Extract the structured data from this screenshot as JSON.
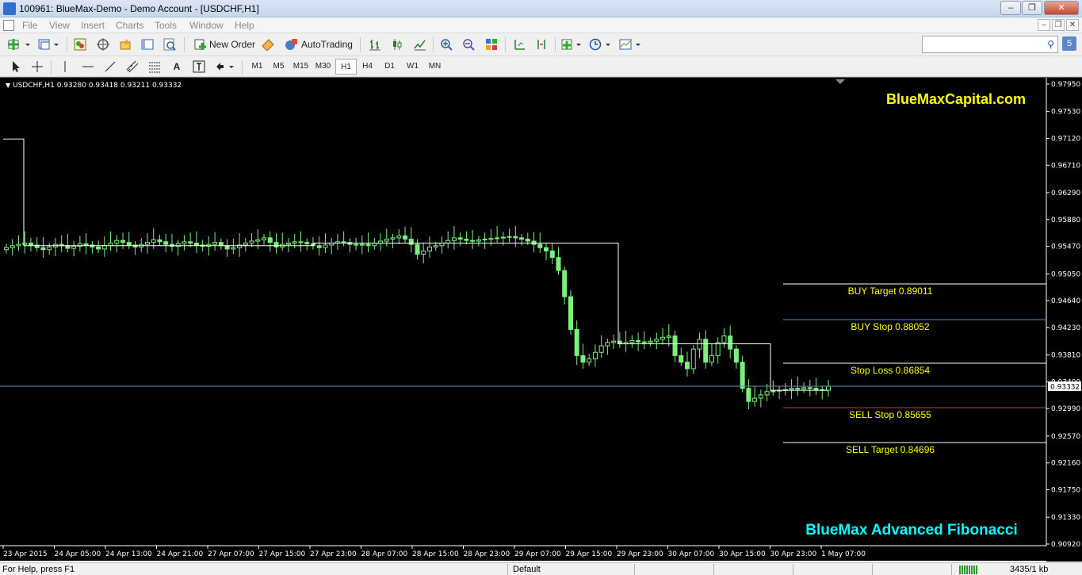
{
  "window": {
    "title": "100961: BlueMax-Demo - Demo Account - [USDCHF,H1]"
  },
  "menu": [
    "File",
    "View",
    "Insert",
    "Charts",
    "Tools",
    "Window",
    "Help"
  ],
  "toolbar": {
    "new_order_label": "New Order",
    "autotrading_label": "AutoTrading",
    "timeframes": [
      "M1",
      "M5",
      "M15",
      "M30",
      "H1",
      "H4",
      "D1",
      "W1",
      "MN"
    ],
    "active_timeframe": "H1",
    "search_placeholder": ""
  },
  "chart": {
    "symbol_info": "USDCHF,H1  0.93280 0.93418 0.93211 0.93332",
    "brand_top": "BlueMaxCapital.com",
    "brand_bottom": "BlueMax Advanced Fibonacci",
    "current_price": "0.93332",
    "price_labels": [
      "0.97950",
      "0.97530",
      "0.97120",
      "0.96710",
      "0.96290",
      "0.95880",
      "0.95470",
      "0.95050",
      "0.94640",
      "0.94230",
      "0.93810",
      "0.93400",
      "0.92990",
      "0.92570",
      "0.92160",
      "0.91750",
      "0.91330",
      "0.90920"
    ],
    "time_labels": [
      "23 Apr 2015",
      "24 Apr 05:00",
      "24 Apr 13:00",
      "24 Apr 21:00",
      "27 Apr 07:00",
      "27 Apr 15:00",
      "27 Apr 23:00",
      "28 Apr 07:00",
      "28 Apr 15:00",
      "28 Apr 23:00",
      "29 Apr 07:00",
      "29 Apr 15:00",
      "29 Apr 23:00",
      "30 Apr 07:00",
      "30 Apr 15:00",
      "30 Apr 23:00",
      "1 May 07:00"
    ],
    "levels": [
      {
        "label": "BUY Target",
        "value": "0.89011",
        "color": "#ffffff"
      },
      {
        "label": "BUY Stop",
        "value": "0.88052",
        "color": "#3b8fd1"
      },
      {
        "label": "Stop Loss",
        "value": "0.86854",
        "color": "#ffffff"
      },
      {
        "label": "SELL Stop",
        "value": "0.85655",
        "color": "#c0392b"
      },
      {
        "label": "SELL Target",
        "value": "0.84696",
        "color": "#ffffff"
      }
    ],
    "colors": {
      "background": "#000000",
      "candle": "#7cf07c",
      "brand_top": "#ffff00",
      "brand_bottom": "#00ffff",
      "level_text": "#ffff00",
      "bid_line": "#6f8fa8"
    }
  },
  "chart_data": {
    "type": "candlestick",
    "symbol": "USDCHF",
    "timeframe": "H1",
    "ylim": [
      0.9092,
      0.9795
    ],
    "close_series": [
      0.9545,
      0.9548,
      0.955,
      0.9552,
      0.9549,
      0.9545,
      0.9542,
      0.9546,
      0.955,
      0.9548,
      0.9544,
      0.9547,
      0.9551,
      0.9549,
      0.9546,
      0.9543,
      0.9548,
      0.9552,
      0.9556,
      0.9553,
      0.9549,
      0.9546,
      0.955,
      0.9553,
      0.9557,
      0.9554,
      0.955,
      0.9547,
      0.9551,
      0.9554,
      0.9552,
      0.9549,
      0.9547,
      0.955,
      0.9553,
      0.9548,
      0.9543,
      0.9545,
      0.9549,
      0.9552,
      0.9555,
      0.9557,
      0.956,
      0.9553,
      0.9546,
      0.955,
      0.9552,
      0.9554,
      0.9553,
      0.9551,
      0.9548,
      0.9545,
      0.9549,
      0.9552,
      0.9554,
      0.9553,
      0.955,
      0.9549,
      0.955,
      0.9548,
      0.9552,
      0.9555,
      0.9558,
      0.956,
      0.9563,
      0.9558,
      0.955,
      0.9535,
      0.954,
      0.9546,
      0.9548,
      0.9552,
      0.9556,
      0.956,
      0.9558,
      0.9556,
      0.9555,
      0.9557,
      0.9558,
      0.9559,
      0.956,
      0.9561,
      0.9562,
      0.956,
      0.9558,
      0.9555,
      0.955,
      0.9545,
      0.954,
      0.953,
      0.951,
      0.947,
      0.942,
      0.938,
      0.937,
      0.9375,
      0.9385,
      0.9395,
      0.94,
      0.9402,
      0.9398,
      0.94,
      0.9403,
      0.9401,
      0.94,
      0.9402,
      0.9405,
      0.9408,
      0.941,
      0.938,
      0.937,
      0.936,
      0.939,
      0.9405,
      0.937,
      0.938,
      0.94,
      0.941,
      0.939,
      0.937,
      0.933,
      0.931,
      0.9315,
      0.932,
      0.9325,
      0.9326,
      0.9327,
      0.9328,
      0.933,
      0.9329,
      0.9331,
      0.933,
      0.9328,
      0.9327,
      0.9333
    ]
  }
}
